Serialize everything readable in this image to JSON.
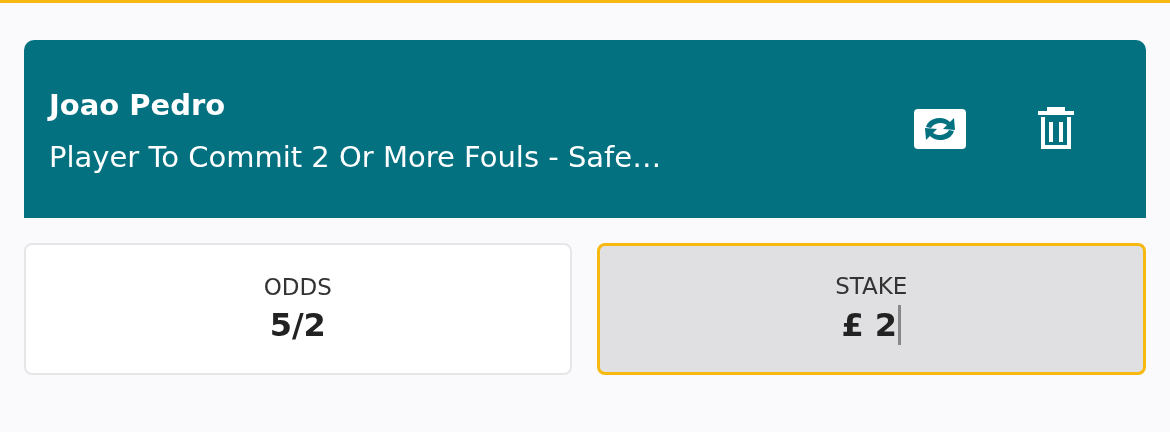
{
  "selection": {
    "player": "Joao Pedro",
    "market": "Player To Commit 2 Or More Fouls - Safe…"
  },
  "odds": {
    "label": "ODDS",
    "value": "5/2"
  },
  "stake": {
    "label": "STAKE",
    "value": "£ 2",
    "focused": true
  }
}
